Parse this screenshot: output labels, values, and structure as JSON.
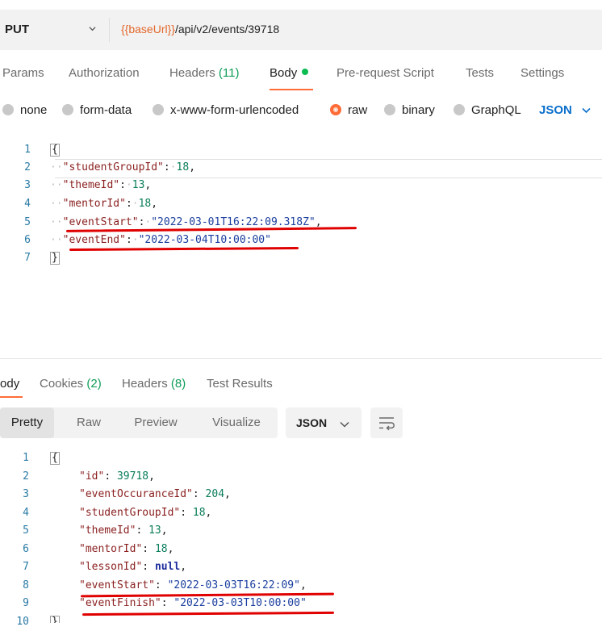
{
  "request": {
    "method": "PUT",
    "url_variable": "{{baseUrl}}",
    "url_path": "/api/v2/events/39718",
    "tabs": [
      {
        "label": "Params",
        "count": ""
      },
      {
        "label": "Authorization",
        "count": ""
      },
      {
        "label": "Headers",
        "count": "(11)"
      },
      {
        "label": "Body",
        "count": ""
      },
      {
        "label": "Pre-request Script",
        "count": ""
      },
      {
        "label": "Tests",
        "count": ""
      },
      {
        "label": "Settings",
        "count": ""
      }
    ],
    "active_tab": "Body",
    "body_types": [
      "none",
      "form-data",
      "x-www-form-urlencoded",
      "raw",
      "binary",
      "GraphQL"
    ],
    "selected_body_type": "raw",
    "format": "JSON",
    "code_line_numbers": [
      "1",
      "2",
      "3",
      "4",
      "5",
      "6",
      "7"
    ],
    "code": {
      "open": "{",
      "student_group_key": "\"studentGroupId\"",
      "student_group_val": "18",
      "theme_key": "\"themeId\"",
      "theme_val": "13",
      "mentor_key": "\"mentorId\"",
      "mentor_val": "18",
      "event_start_key": "\"eventStart\"",
      "event_start_val": "\"2022-03-01T16:22:09.318Z\"",
      "event_end_key": "\"eventEnd\"",
      "event_end_val": "\"2022-03-04T10:00:00\"",
      "close": "}"
    }
  },
  "response": {
    "tabs": [
      {
        "label": "Body",
        "count": ""
      },
      {
        "label": "Cookies",
        "count": "(2)"
      },
      {
        "label": "Headers",
        "count": "(8)"
      },
      {
        "label": "Test Results",
        "count": ""
      }
    ],
    "view_modes": [
      "Pretty",
      "Raw",
      "Preview",
      "Visualize"
    ],
    "active_view": "Pretty",
    "format": "JSON",
    "code_line_numbers": [
      "1",
      "2",
      "3",
      "4",
      "5",
      "6",
      "7",
      "8",
      "9",
      "10"
    ],
    "code": {
      "open": "{",
      "id_key": "\"id\"",
      "id_val": "39718",
      "occ_key": "\"eventOccuranceId\"",
      "occ_val": "204",
      "student_group_key": "\"studentGroupId\"",
      "student_group_val": "18",
      "theme_key": "\"themeId\"",
      "theme_val": "13",
      "mentor_key": "\"mentorId\"",
      "mentor_val": "18",
      "lesson_key": "\"lessonId\"",
      "lesson_val": "null",
      "event_start_key": "\"eventStart\"",
      "event_start_val": "\"2022-03-03T16:22:09\"",
      "event_finish_key": "\"eventFinish\"",
      "event_finish_val": "\"2022-03-03T10:00:00\"",
      "close": "}"
    }
  },
  "colors": {
    "accent": "#ff6c37",
    "link_blue": "#0b6fcc",
    "success_green": "#0cbb52",
    "annotation_red": "#e00000"
  },
  "icons": [
    "chevron-down-icon",
    "status-dot-icon",
    "radio-icon",
    "wrap-lines-icon"
  ]
}
